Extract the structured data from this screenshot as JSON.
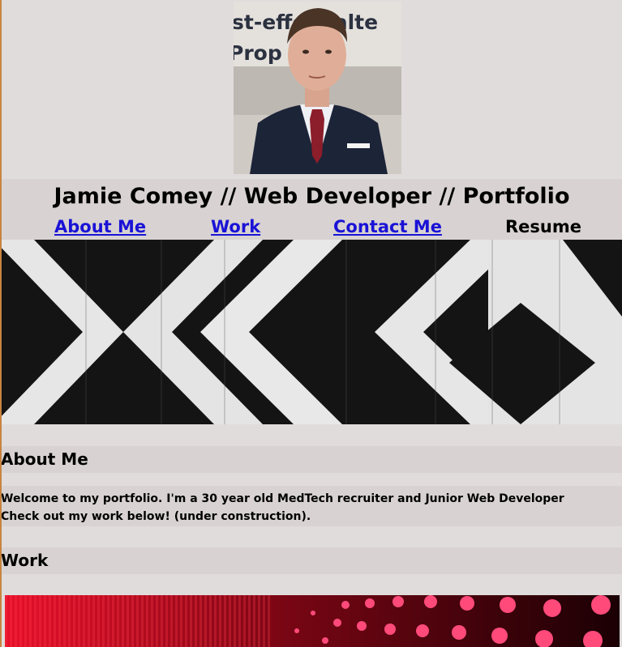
{
  "header": {
    "portrait_alt": "Portrait of Jamie Comey",
    "portrait_backdrop_text": [
      "st-effe   e alte",
      "Prop     ecur"
    ],
    "title": "Jamie Comey // Web Developer // Portfolio"
  },
  "nav": {
    "items": [
      {
        "label": "About Me",
        "link": true
      },
      {
        "label": "Work",
        "link": true
      },
      {
        "label": "Contact Me",
        "link": true
      },
      {
        "label": "Resume",
        "link": false
      }
    ]
  },
  "sections": {
    "about": {
      "heading": "About Me",
      "body": "Welcome to my portfolio. I'm a 30 year old MedTech recruiter and Junior Web Developer Check out my work below! (under construction)."
    },
    "work": {
      "heading": "Work"
    }
  },
  "colors": {
    "page_background": "#e0dcdb",
    "band_background": "#d8d3d2",
    "link": "#1a12d6",
    "left_edge": "#c8843f",
    "work_thumb_red": "#e8102a"
  },
  "icons": {
    "hero": "black-white-chevron-wood-banner",
    "work_thumb": "red-led-dots-thumbnail"
  }
}
